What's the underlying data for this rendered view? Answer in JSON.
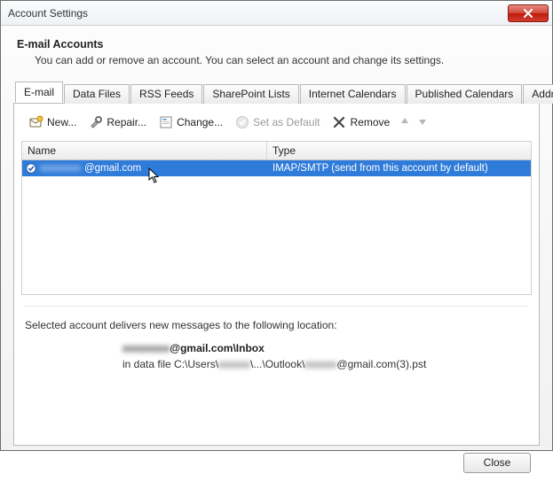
{
  "window": {
    "title": "Account Settings"
  },
  "header": {
    "title": "E-mail Accounts",
    "subtitle": "You can add or remove an account. You can select an account and change its settings."
  },
  "tabs": {
    "t0": "E-mail",
    "t1": "Data Files",
    "t2": "RSS Feeds",
    "t3": "SharePoint Lists",
    "t4": "Internet Calendars",
    "t5": "Published Calendars",
    "t6": "Address Books"
  },
  "toolbar": {
    "new_": "New...",
    "repair": "Repair...",
    "change": "Change...",
    "set_default": "Set as Default",
    "remove": "Remove"
  },
  "columns": {
    "name": "Name",
    "type": "Type"
  },
  "account": {
    "name_blur": "xxxxxxxx",
    "name_tail": "@gmail.com",
    "type": "IMAP/SMTP (send from this account by default)"
  },
  "delivery": {
    "intro": "Selected account delivers new messages to the following location:",
    "loc_blur1": "xxxxxxxx",
    "loc_bold_tail": "@gmail.com\\Inbox",
    "path_prefix": "in data file C:\\Users\\",
    "path_blur": "xxxxxx",
    "path_mid": "\\...\\Outlook\\",
    "path_blur2": "xxxxxx",
    "path_tail": "@gmail.com(3).pst"
  },
  "buttons": {
    "close": "Close"
  }
}
